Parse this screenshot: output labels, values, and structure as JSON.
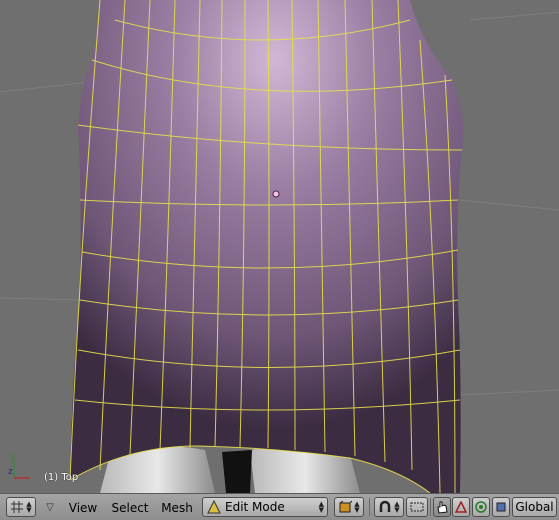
{
  "viewport": {
    "view_label": "(1) Top",
    "colors": {
      "background": "#6f6f6f",
      "mesh_fill": "#8a6e92",
      "wire": "#e8e04a"
    }
  },
  "toolbar": {
    "editor_type_icon": "grid-icon",
    "menus": [
      "View",
      "Select",
      "Mesh"
    ],
    "mode": {
      "label": "Edit Mode",
      "icon": "edit-mode-icon"
    },
    "draw_type_icon": "cube-icon",
    "pivot_icon": "magnet-icon",
    "select_icons": [
      "hand-icon",
      "triangle-icon",
      "circle-target-icon",
      "square-icon"
    ],
    "orientation_label": "Global"
  }
}
